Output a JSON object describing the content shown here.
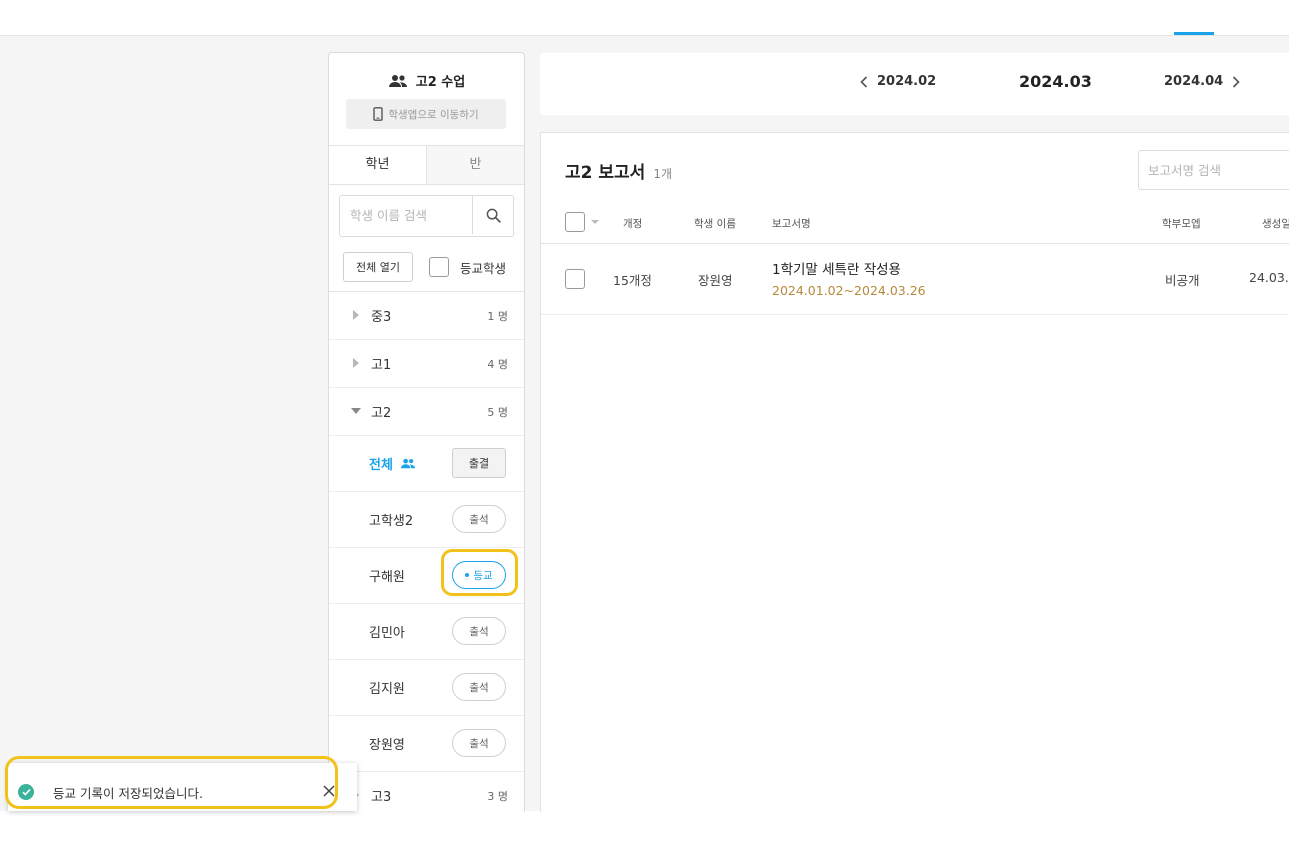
{
  "class_panel": {
    "title": "고2 수업",
    "title_icon": "group-icon",
    "student_app_label": "학생앱으로 이동하기",
    "tabs": [
      {
        "label": "학년",
        "active": true
      },
      {
        "label": "반",
        "active": false
      }
    ],
    "search_placeholder": "학생 이름 검색",
    "open_all_label": "전체 열기",
    "attend_filter_label": "등교학생",
    "grades": [
      {
        "name": "중3",
        "count": "1 명",
        "expanded": false
      },
      {
        "name": "고1",
        "count": "4 명",
        "expanded": false
      },
      {
        "name": "고2",
        "count": "5 명",
        "expanded": true
      },
      {
        "name": "고3",
        "count": "3 명",
        "expanded": false
      }
    ],
    "all_row": {
      "label": "전체",
      "button": "출결"
    },
    "students": [
      {
        "name": "고학생2",
        "status": "출석"
      },
      {
        "name": "구해원",
        "status": "등교",
        "active": true
      },
      {
        "name": "김민아",
        "status": "출석"
      },
      {
        "name": "김지원",
        "status": "출석"
      },
      {
        "name": "장원영",
        "status": "출석"
      }
    ]
  },
  "month_nav": {
    "prev": "2024.02",
    "current": "2024.03",
    "next": "2024.04"
  },
  "report": {
    "title": "고2 보고서",
    "count": "1개",
    "search_placeholder": "보고서명 검색",
    "columns": [
      "개정",
      "학생 이름",
      "보고서명",
      "학부모엡",
      "생성일"
    ],
    "rows": [
      {
        "revision": "15개정",
        "student": "장원영",
        "name": "1학기말 세특란 작성용",
        "period": "2024.01.02~2024.03.26",
        "parent_visibility": "비공개",
        "created": "24.03."
      }
    ]
  },
  "toast": {
    "message": "등교 기록이 저장되었습니다.",
    "icon": "check-circle-icon"
  },
  "colors": {
    "accent": "#1aa3e8",
    "highlight": "#f2c21b",
    "period": "#b58a3b",
    "success": "#3bb39b"
  }
}
